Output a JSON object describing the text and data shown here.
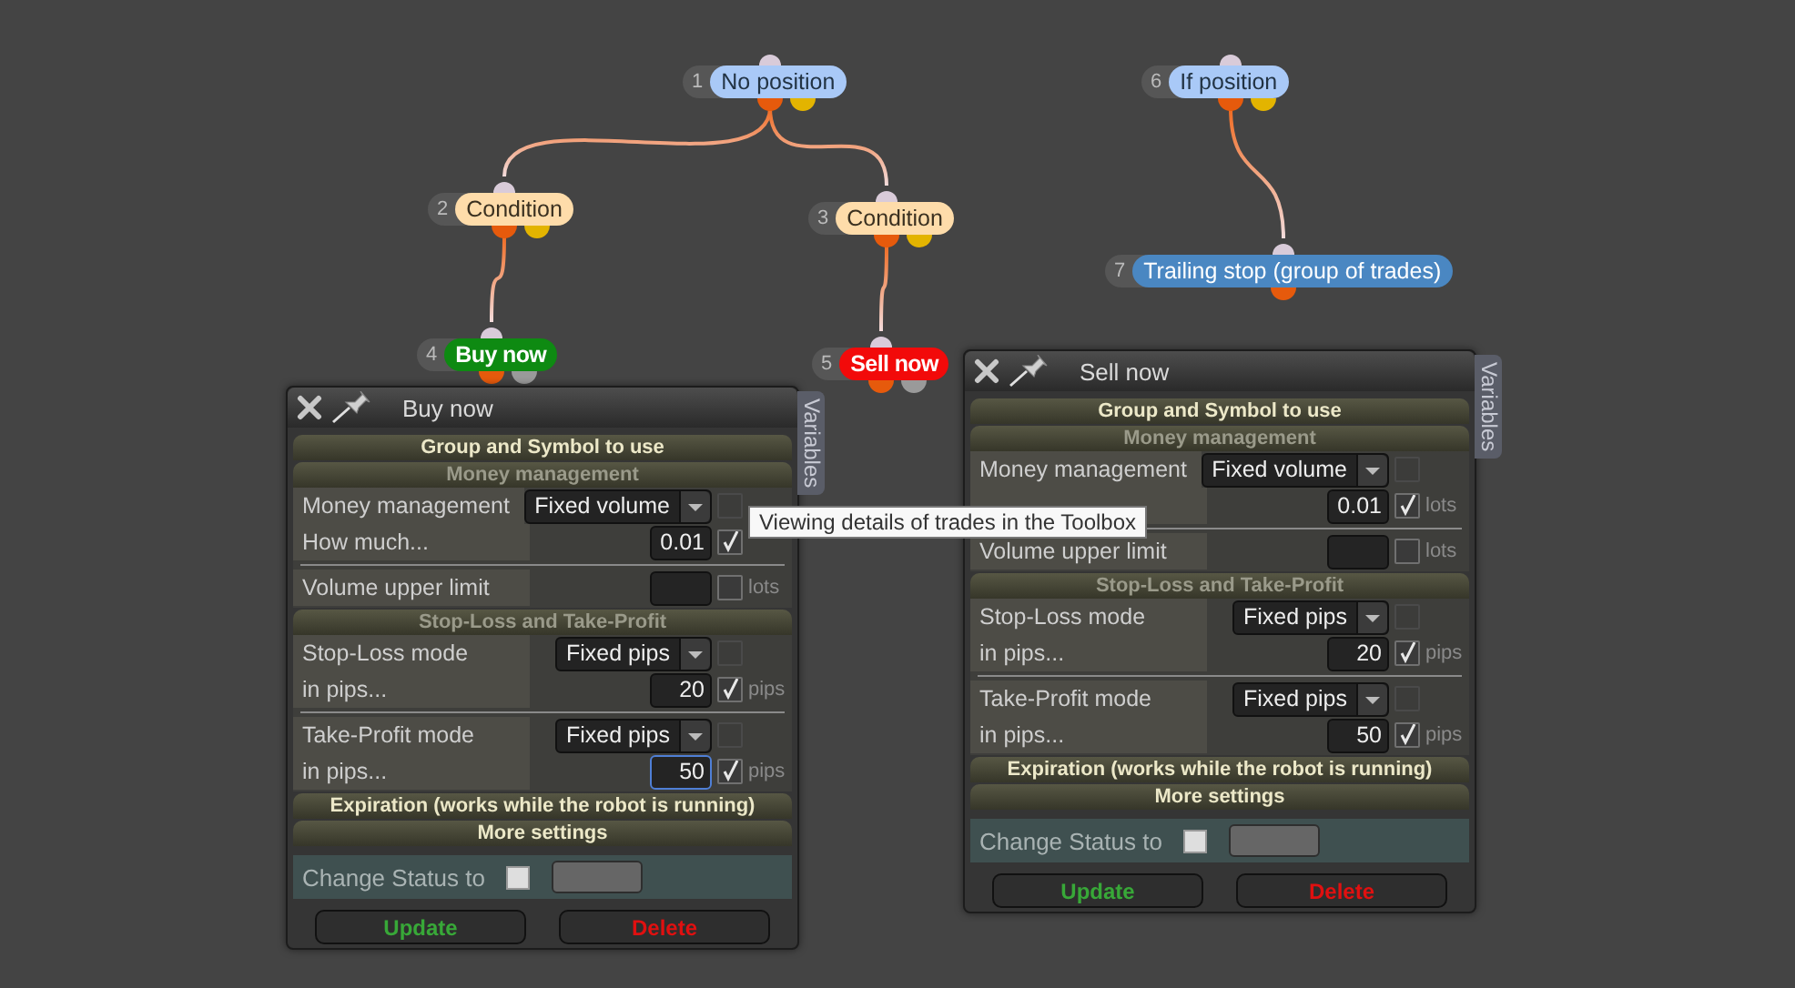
{
  "nodes": [
    {
      "number": "1",
      "label": "No position",
      "kind": "start",
      "children": [
        {
          "number": "2",
          "label": "Condition",
          "kind": "condition",
          "children": [
            {
              "number": "4",
              "label": "Buy now",
              "kind": "buy"
            }
          ]
        },
        {
          "number": "3",
          "label": "Condition",
          "kind": "condition",
          "children": [
            {
              "number": "5",
              "label": "Sell now",
              "kind": "sell"
            }
          ]
        }
      ]
    },
    {
      "number": "6",
      "label": "If position",
      "kind": "start",
      "children": [
        {
          "number": "7",
          "label": "Trailing stop (group of trades)",
          "kind": "action"
        }
      ]
    }
  ],
  "panels": [
    {
      "title": "Buy now",
      "tab": "Variables",
      "sections": [
        {
          "title": "Group and Symbol to use",
          "expanded": false
        },
        {
          "title": "Money management",
          "expanded": true,
          "groups": [
            [
              {
                "kind": "select",
                "label": "Money management",
                "value": "Fixed volume",
                "checked": false,
                "disabled": true
              },
              {
                "kind": "number",
                "label": "How much...",
                "value": "0.01",
                "checked": true,
                "focused": false
              }
            ],
            [
              {
                "kind": "number",
                "label": "Volume upper limit",
                "checked": false,
                "unit": "lots",
                "focused": false
              }
            ]
          ]
        },
        {
          "title": "Stop-Loss and Take-Profit",
          "expanded": true,
          "groups": [
            [
              {
                "kind": "select",
                "label": "Stop-Loss mode",
                "value": "Fixed pips",
                "checked": false,
                "disabled": true
              },
              {
                "kind": "number",
                "label": "in pips...",
                "value": "20",
                "checked": true,
                "unit": "pips",
                "focused": false
              }
            ],
            [
              {
                "kind": "select",
                "label": "Take-Profit mode",
                "value": "Fixed pips",
                "checked": false,
                "disabled": true
              },
              {
                "kind": "number",
                "label": "in pips...",
                "value": "50",
                "checked": true,
                "unit": "pips",
                "focused": true
              }
            ]
          ]
        },
        {
          "title": "Expiration (works while the robot is running)",
          "expanded": false
        },
        {
          "title": "More settings",
          "expanded": false
        }
      ],
      "status": {
        "label": "Change Status to",
        "checked": false
      },
      "buttons": [
        {
          "label": "Update",
          "kind": "confirm"
        },
        {
          "label": "Delete",
          "kind": "danger"
        }
      ]
    },
    {
      "title": "Sell now",
      "tab": "Variables",
      "sections": [
        {
          "title": "Group and Symbol to use",
          "expanded": false
        },
        {
          "title": "Money management",
          "expanded": true,
          "groups": [
            [
              {
                "kind": "select",
                "label": "Money management",
                "value": "Fixed volume",
                "checked": false,
                "disabled": true
              },
              {
                "kind": "number",
                "value": "0.01",
                "checked": true,
                "unit": "lots",
                "focused": false
              }
            ],
            [
              {
                "kind": "number",
                "label": "Volume upper limit",
                "checked": false,
                "unit": "lots",
                "focused": false
              }
            ]
          ]
        },
        {
          "title": "Stop-Loss and Take-Profit",
          "expanded": true,
          "groups": [
            [
              {
                "kind": "select",
                "label": "Stop-Loss mode",
                "value": "Fixed pips",
                "checked": false,
                "disabled": true
              },
              {
                "kind": "number",
                "label": "in pips...",
                "value": "20",
                "checked": true,
                "unit": "pips",
                "focused": false
              }
            ],
            [
              {
                "kind": "select",
                "label": "Take-Profit mode",
                "value": "Fixed pips",
                "checked": false,
                "disabled": true
              },
              {
                "kind": "number",
                "label": "in pips...",
                "value": "50",
                "checked": true,
                "unit": "pips",
                "focused": false
              }
            ]
          ]
        },
        {
          "title": "Expiration (works while the robot is running)",
          "expanded": false
        },
        {
          "title": "More settings",
          "expanded": false
        }
      ],
      "status": {
        "label": "Change Status to",
        "checked": false
      },
      "buttons": [
        {
          "label": "Update",
          "kind": "confirm"
        },
        {
          "label": "Delete",
          "kind": "danger"
        }
      ]
    }
  ],
  "tooltip": "Viewing details of trades in the Toolbox"
}
